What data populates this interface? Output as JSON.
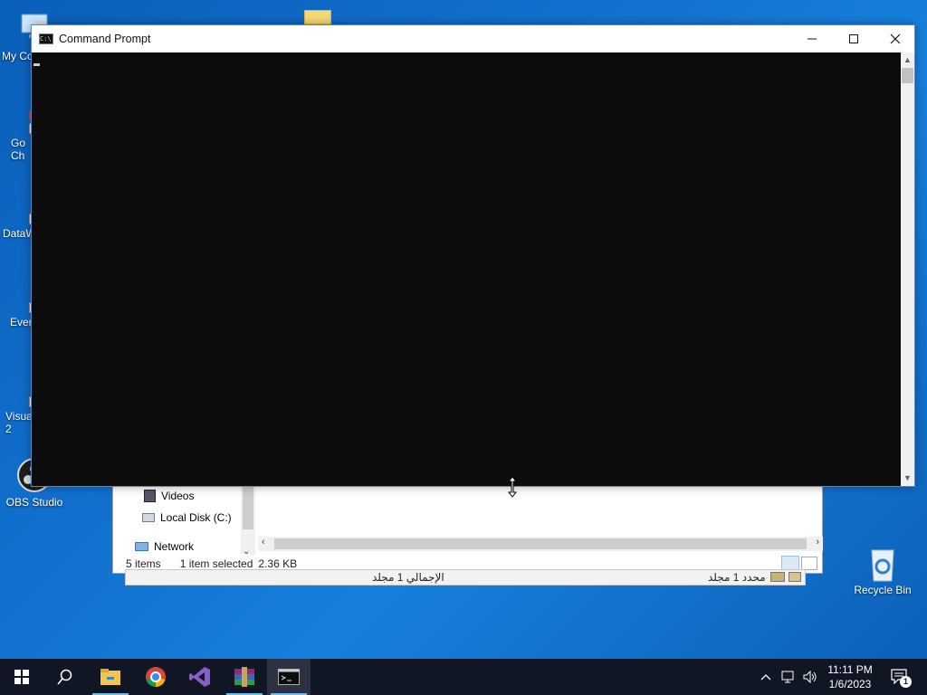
{
  "desktop": {
    "icons": [
      {
        "label": "My Co",
        "name": "my-computer"
      },
      {
        "label": "Go\nCh",
        "name": "google-chrome"
      },
      {
        "label": "DataW",
        "name": "datawrapper"
      },
      {
        "label": "Ever",
        "name": "everything"
      },
      {
        "label": "Visua\n2",
        "name": "visual-studio"
      },
      {
        "label": "OBS Studio",
        "name": "obs-studio"
      },
      {
        "label": "Recycle Bin",
        "name": "recycle-bin"
      }
    ]
  },
  "explorer": {
    "nav_items": [
      "Videos",
      "Local Disk (C:)",
      "Network"
    ],
    "status": {
      "items": "5 items",
      "selected": "1 item selected",
      "size": "2.36 KB"
    }
  },
  "explorer2": {
    "total_text": "الإجمالي 1 مجلد",
    "selected_text": "محدد 1 مجلد"
  },
  "cmd": {
    "title": "Command Prompt",
    "minimize_symbol": "—",
    "maximize_symbol": "☐",
    "close_symbol": "✕"
  },
  "taskbar": {
    "buttons": [
      "start-icon",
      "search-icon",
      "file-explorer-icon",
      "chrome-icon",
      "visual-studio-icon",
      "winrar-icon",
      "command-prompt-icon"
    ],
    "clock": {
      "time": "11:11 PM",
      "date": "1/6/2023"
    },
    "notification_count": "1"
  },
  "colors": {
    "desktop_bg": "#1272d0",
    "console_bg": "#0c0c0c",
    "taskbar_bg": "#101624",
    "accent": "#76b9ed"
  }
}
